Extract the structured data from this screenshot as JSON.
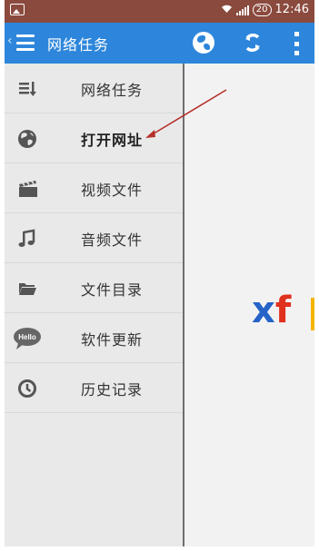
{
  "status_bar": {
    "battery": "20",
    "time": "12:46",
    "left_icon": "image-notification-icon",
    "wifi_icon": "wifi-icon",
    "signal_icon": "signal-icon",
    "color": "#8b4a3e"
  },
  "action_bar": {
    "title": "网络任务",
    "back_glyph": "‹",
    "color": "#2d86db",
    "actions": [
      "globe-icon",
      "refresh-icon",
      "overflow-menu-icon"
    ]
  },
  "drawer": {
    "items": [
      {
        "label": "网络任务",
        "icon": "task-list-icon",
        "active": false
      },
      {
        "label": "打开网址",
        "icon": "globe-icon",
        "active": true
      },
      {
        "label": "视频文件",
        "icon": "film-icon",
        "active": false
      },
      {
        "label": "音频文件",
        "icon": "music-note-icon",
        "active": false
      },
      {
        "label": "文件目录",
        "icon": "folder-icon",
        "active": false
      },
      {
        "label": "软件更新",
        "icon": "hello-bubble-icon",
        "active": false
      },
      {
        "label": "历史记录",
        "icon": "clock-icon",
        "active": false
      }
    ]
  },
  "content": {
    "logo_x": "x",
    "logo_f": "f",
    "hello_badge": "Hello"
  }
}
